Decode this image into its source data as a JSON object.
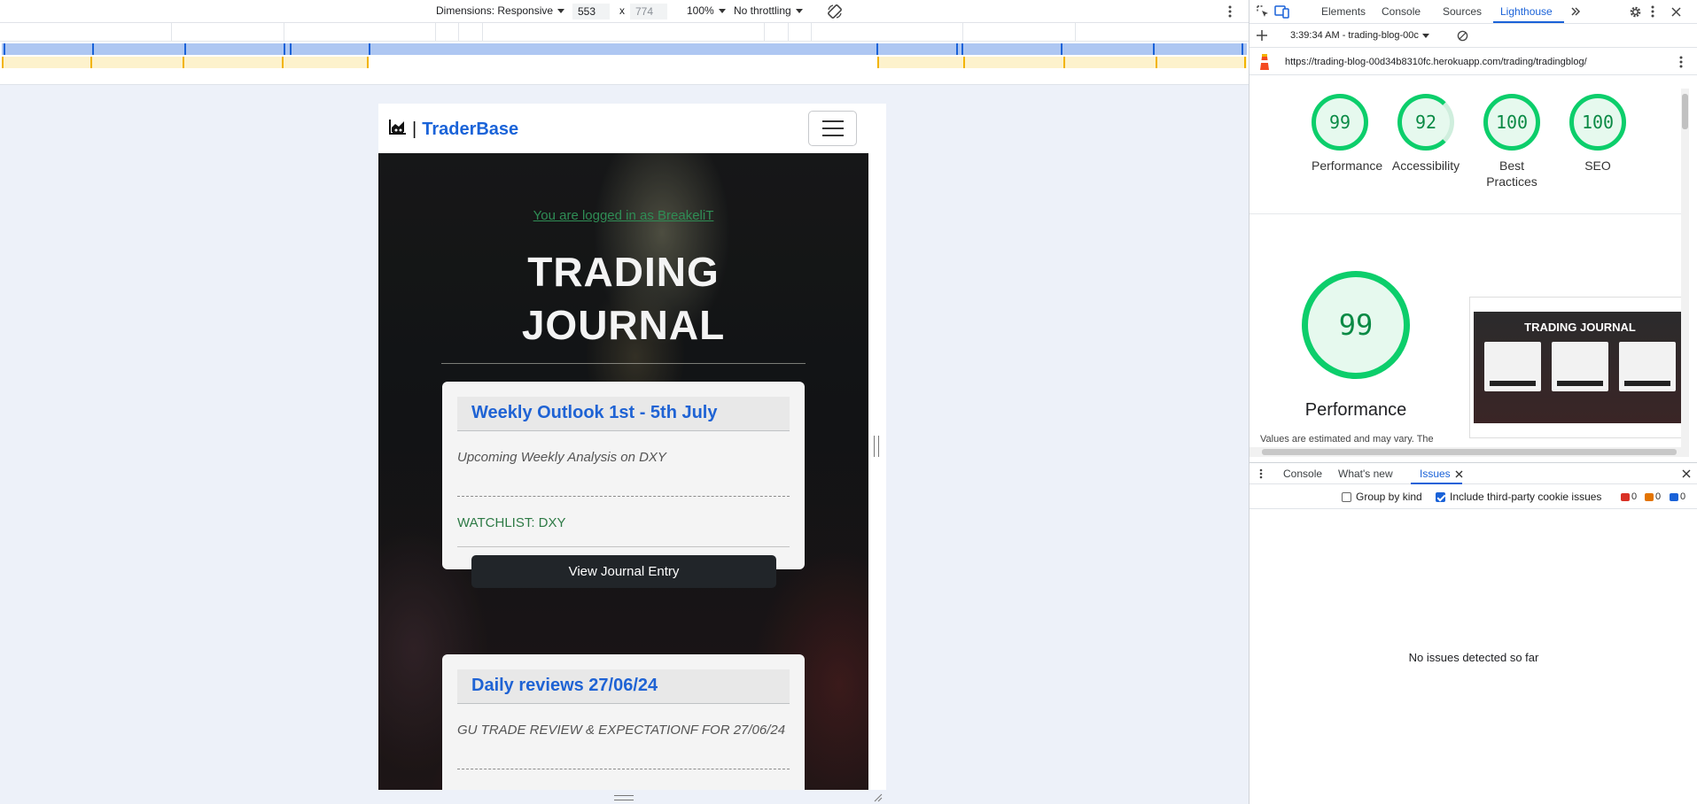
{
  "device_toolbar": {
    "dimensions_label": "Dimensions: Responsive",
    "width_value": "553",
    "times": "x",
    "height_value": "774",
    "zoom_label": "100%",
    "throttle_label": "No throttling",
    "rotate_icon": "rotate-icon",
    "more_icon": "more-vert-icon"
  },
  "site": {
    "brand_sep": "|",
    "brand_name": "TraderBase",
    "brand_icon": "chart-area-icon",
    "menu_icon": "hamburger-icon",
    "login_text": "You are logged in as BreakeliT",
    "title_line1": "TRADING",
    "title_line2": "JOURNAL",
    "entries": [
      {
        "title": "Weekly Outlook 1st - 5th July",
        "subtitle": "Upcoming Weekly Analysis on DXY",
        "watchlist": "WATCHLIST: DXY",
        "button": "View Journal Entry"
      },
      {
        "title": "Daily reviews 27/06/24",
        "subtitle": "GU TRADE REVIEW & EXPECTATIONF FOR 27/06/24"
      }
    ],
    "accent_color": "#1a63d8",
    "link_color": "#2f8d55"
  },
  "devtools": {
    "tabs": [
      "Elements",
      "Console",
      "Sources",
      "Lighthouse"
    ],
    "active_tab": "Lighthouse",
    "more_tabs_icon": "chevron-double-right-icon",
    "report_time": "3:39:34 AM - trading-blog-00c",
    "url": "https://trading-blog-00d34b8310fc.herokuapp.com/trading/tradingblog/",
    "scores": [
      {
        "value": "99",
        "label": "Performance"
      },
      {
        "value": "92",
        "label": "Accessibility"
      },
      {
        "value": "100",
        "label": "Best Practices"
      },
      {
        "value": "100",
        "label": "SEO"
      }
    ],
    "big_score": "99",
    "big_label": "Performance",
    "values_note": "Values are estimated and may vary. The",
    "thumb_title": "TRADING JOURNAL",
    "good_color": "#0cce6b",
    "drawer_tabs": [
      "Console",
      "What's new",
      "Issues"
    ],
    "active_drawer_tab": "Issues",
    "group_by_kind": "Group by kind",
    "include_third_party": "Include third-party cookie issues",
    "counts": {
      "errors": "0",
      "warnings": "0",
      "info": "0"
    },
    "no_issues": "No issues detected so far"
  }
}
